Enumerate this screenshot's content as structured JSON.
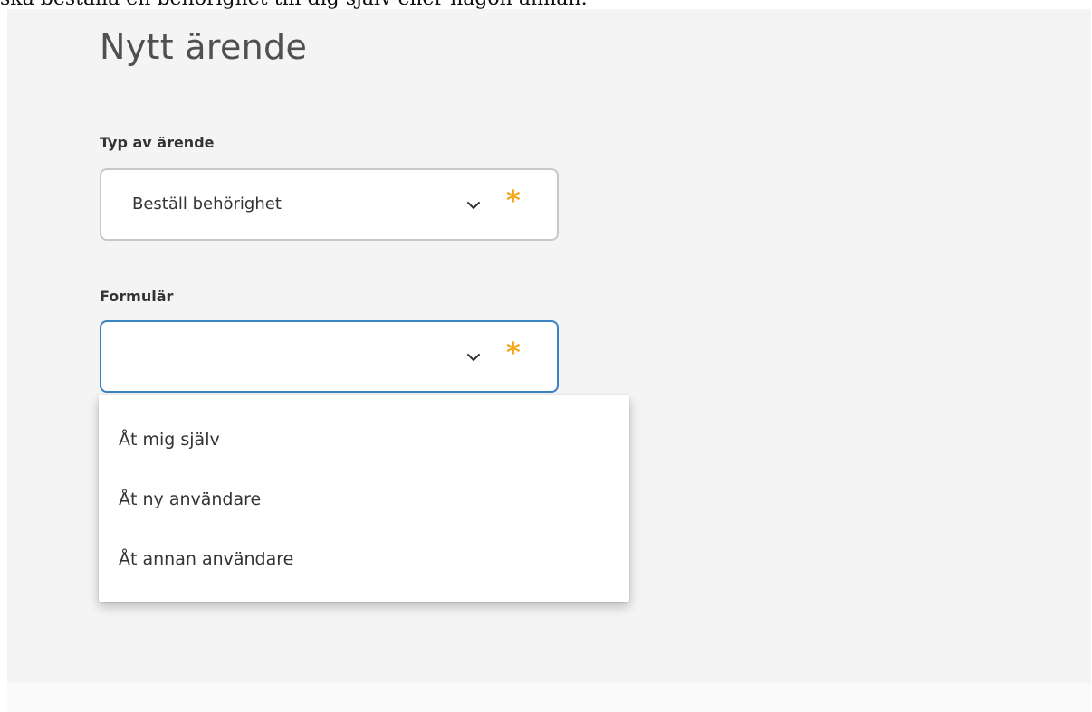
{
  "intro_text": "ska beställa en behörighet till dig själv eller någon annan.",
  "page_title": "Nytt ärende",
  "fields": {
    "type": {
      "label": "Typ av ärende",
      "value": "Beställ behörighet",
      "required_mark": "*"
    },
    "form": {
      "label": "Formulär",
      "value": "",
      "required_mark": "*",
      "options": [
        "Åt mig själv",
        "Åt ny användare",
        "Åt annan användare"
      ]
    }
  },
  "colors": {
    "required": "#f5a623",
    "focus_border": "#3b83c3",
    "panel_bg": "#f4f4f4"
  },
  "icons": {
    "chevron": "chevron-down-icon",
    "required": "asterisk-icon"
  }
}
